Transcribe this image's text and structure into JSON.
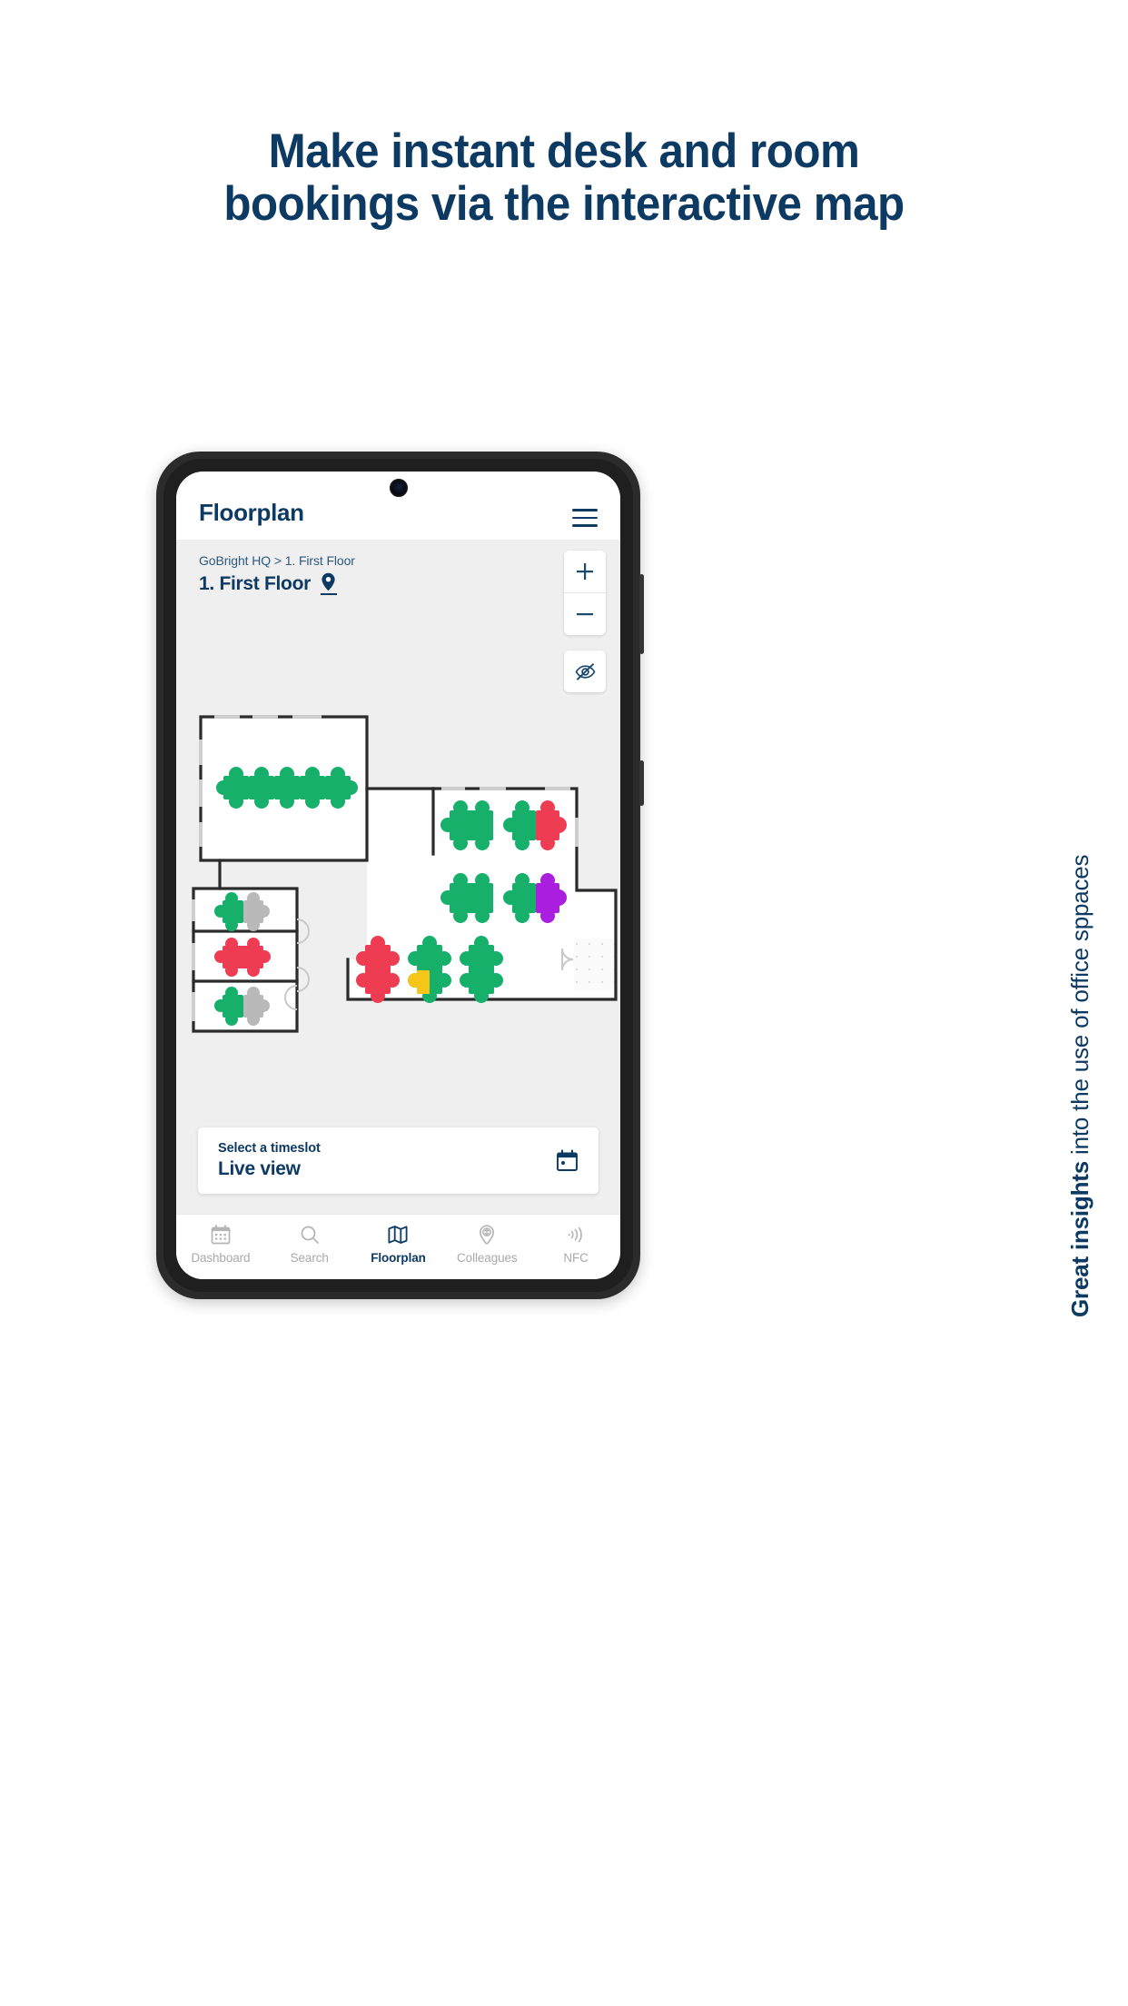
{
  "promo": {
    "heading_line1": "Make instant desk and room",
    "heading_line2": "bookings via the interactive map",
    "side_caption_bold": "Great insights",
    "side_caption_rest": " into the use of office sppaces"
  },
  "colors": {
    "brand_navy": "#0d3a63",
    "breadcrumb": "#2d597f",
    "desk_available": "#16b06b",
    "desk_occupied": "#ee3d53",
    "desk_reserved": "#aa1ee0",
    "desk_inactive": "#b9b9b9",
    "desk_partial": "#f5c518",
    "map_background": "#efefef",
    "wall": "#2b2b2b"
  },
  "app": {
    "title": "Floorplan",
    "menu_icon": "hamburger-menu-icon"
  },
  "map": {
    "breadcrumb": "GoBright HQ > 1. First Floor",
    "floor_title": "1. First Floor",
    "pin_icon": "location-pin-icon",
    "zoom_in_label": "+",
    "zoom_out_label": "−",
    "visibility_icon": "eye-off-icon"
  },
  "timeslot": {
    "label": "Select a timeslot",
    "value": "Live view",
    "calendar_icon": "calendar-icon"
  },
  "bottom_nav": {
    "items": [
      {
        "label": "Dashboard",
        "icon": "calendar-icon",
        "active": false
      },
      {
        "label": "Search",
        "icon": "search-icon",
        "active": false
      },
      {
        "label": "Floorplan",
        "icon": "map-icon",
        "active": true
      },
      {
        "label": "Colleagues",
        "icon": "colleague-pin-icon",
        "active": false
      },
      {
        "label": "NFC",
        "icon": "nfc-waves-icon",
        "active": false
      }
    ]
  },
  "floorplan": {
    "desks": [
      {
        "room": "meeting-room-large",
        "status": "available"
      },
      {
        "room": "meeting-room-large",
        "status": "available"
      },
      {
        "room": "meeting-room-large",
        "status": "available"
      },
      {
        "room": "meeting-room-large",
        "status": "available"
      },
      {
        "room": "meeting-room-large",
        "status": "available"
      },
      {
        "room": "office-right-top",
        "status": "available"
      },
      {
        "room": "office-right-top",
        "status": "available"
      },
      {
        "room": "office-right-top",
        "status": "available"
      },
      {
        "room": "office-right-top",
        "status": "occupied"
      },
      {
        "room": "office-right-bottom",
        "status": "available"
      },
      {
        "room": "office-right-bottom",
        "status": "available"
      },
      {
        "room": "office-right-bottom",
        "status": "available"
      },
      {
        "room": "office-right-bottom",
        "status": "reserved"
      },
      {
        "room": "open-space",
        "status": "occupied"
      },
      {
        "room": "open-space",
        "status": "partial"
      },
      {
        "room": "open-space",
        "status": "available"
      },
      {
        "room": "small-room-1",
        "status": "available"
      },
      {
        "room": "small-room-1",
        "status": "inactive"
      },
      {
        "room": "small-room-2",
        "status": "occupied"
      },
      {
        "room": "small-room-3",
        "status": "available"
      },
      {
        "room": "small-room-3",
        "status": "inactive"
      }
    ]
  }
}
